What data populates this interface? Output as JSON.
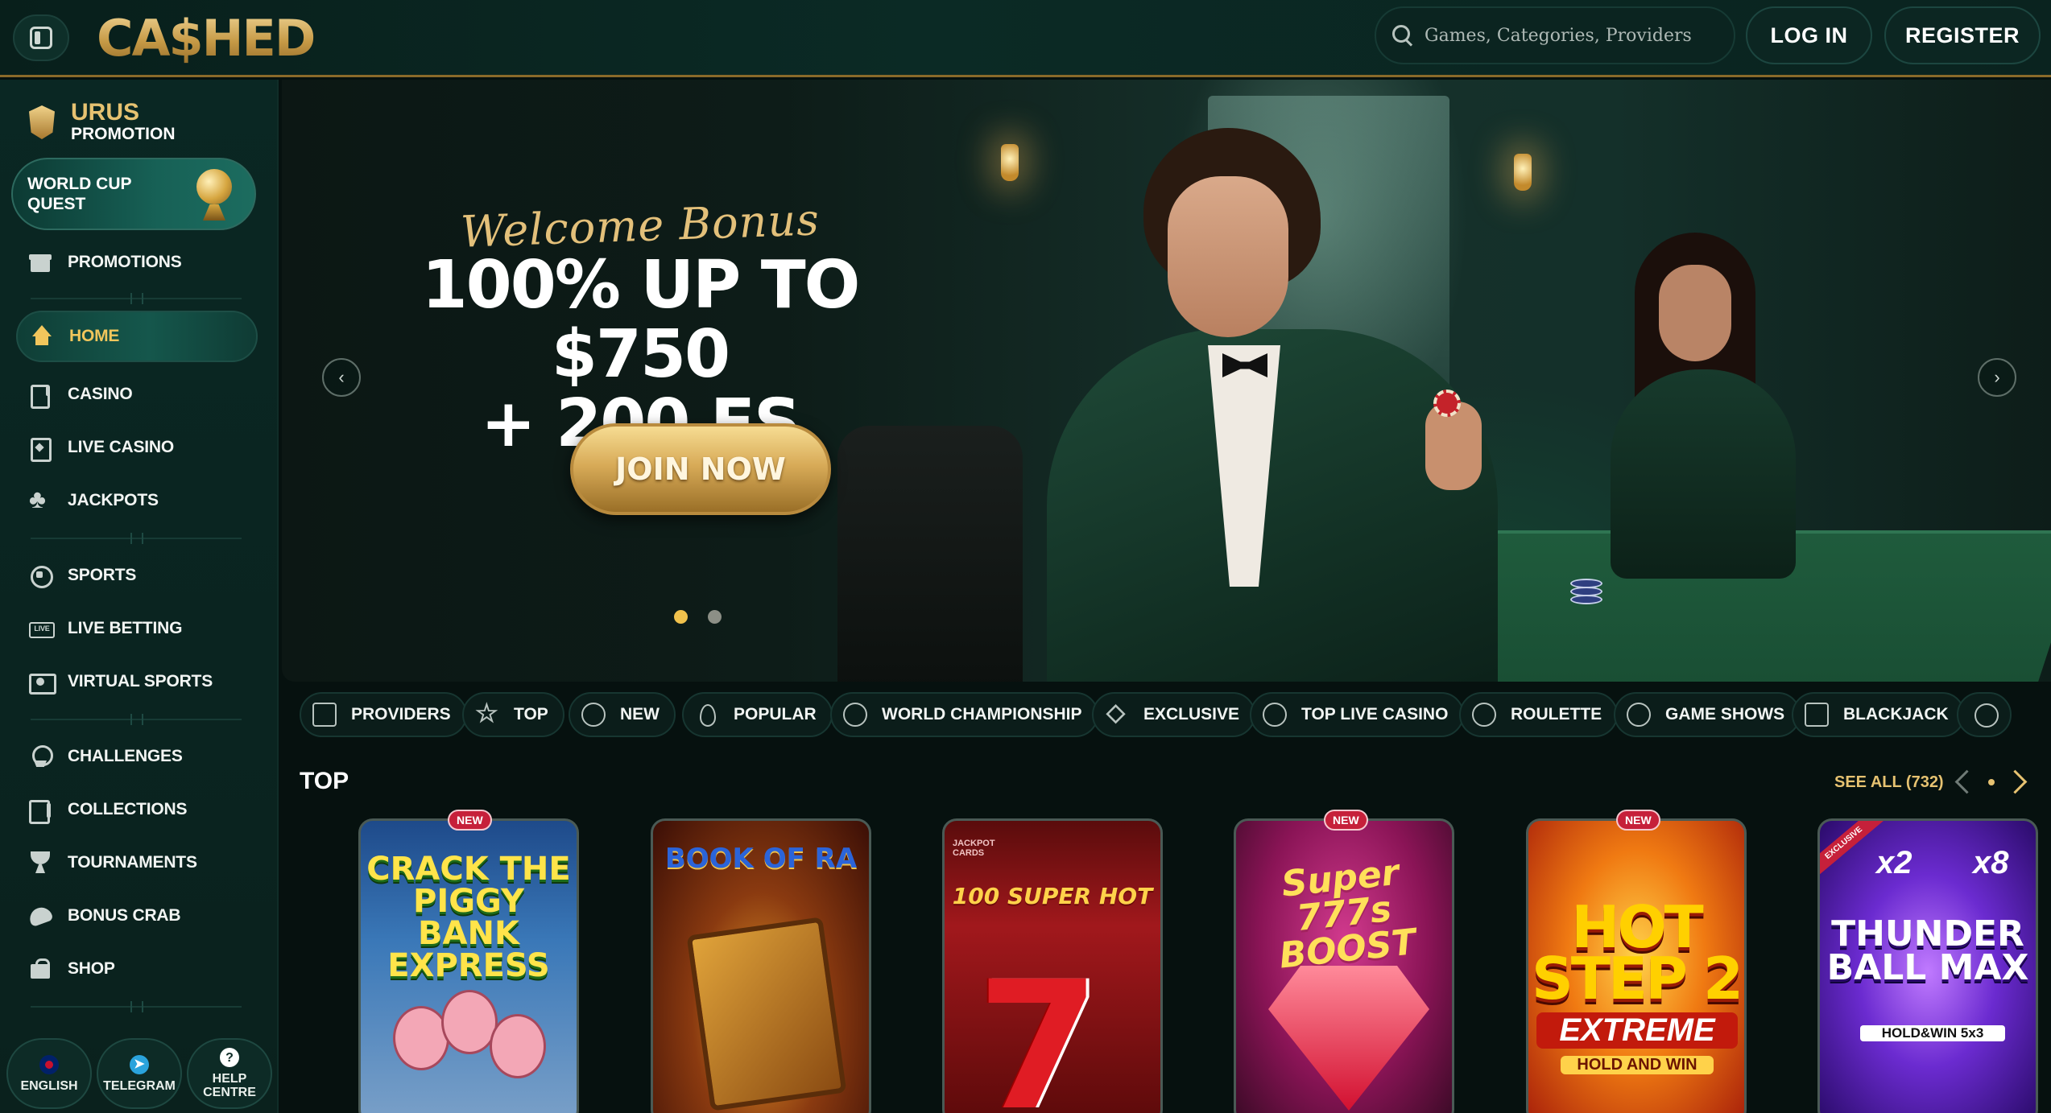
{
  "header": {
    "logo": "CA$HED",
    "search_placeholder": "Games, Categories, Providers",
    "login_label": "LOG IN",
    "register_label": "REGISTER"
  },
  "sidebar": {
    "promo_title": "URUS",
    "promo_subtitle": "PROMOTION",
    "world_cup": "WORLD CUP QUEST",
    "items": [
      {
        "label": "PROMOTIONS",
        "icon": "gift-icon"
      },
      {
        "label": "HOME",
        "icon": "home-icon",
        "active": true
      },
      {
        "label": "CASINO",
        "icon": "slot-machine-icon"
      },
      {
        "label": "LIVE CASINO",
        "icon": "live-cards-icon"
      },
      {
        "label": "JACKPOTS",
        "icon": "clover-icon"
      },
      {
        "label": "SPORTS",
        "icon": "football-icon"
      },
      {
        "label": "LIVE BETTING",
        "icon": "live-badge-icon"
      },
      {
        "label": "VIRTUAL SPORTS",
        "icon": "virtual-screen-icon"
      },
      {
        "label": "CHALLENGES",
        "icon": "medal-icon"
      },
      {
        "label": "COLLECTIONS",
        "icon": "cards-collection-icon"
      },
      {
        "label": "TOURNAMENTS",
        "icon": "trophy-icon"
      },
      {
        "label": "BONUS CRAB",
        "icon": "crab-claw-icon"
      },
      {
        "label": "SHOP",
        "icon": "shopping-bag-icon"
      }
    ],
    "bottom": [
      {
        "label": "ENGLISH",
        "icon": "flag-icon"
      },
      {
        "label": "TELEGRAM",
        "icon": "telegram-icon"
      },
      {
        "label": "HELP CENTRE",
        "icon": "help-icon",
        "glyph": "?"
      }
    ]
  },
  "hero": {
    "welcome": "Welcome Bonus",
    "line1": "100% UP TO $750",
    "line2": "+ 200 FS",
    "cta": "JOIN NOW",
    "slides": 2,
    "active_slide": 1
  },
  "categories": [
    {
      "label": "PROVIDERS"
    },
    {
      "label": "TOP"
    },
    {
      "label": "NEW"
    },
    {
      "label": "POPULAR"
    },
    {
      "label": "WORLD CHAMPIONSHIP"
    },
    {
      "label": "EXCLUSIVE"
    },
    {
      "label": "TOP LIVE CASINO"
    },
    {
      "label": "ROULETTE"
    },
    {
      "label": "GAME SHOWS"
    },
    {
      "label": "BLACKJACK"
    }
  ],
  "top_section": {
    "title": "TOP",
    "see_all": "SEE ALL (732)",
    "games": [
      {
        "title": "CRACK THE PIGGY BANK EXPRESS",
        "badge": "NEW"
      },
      {
        "title": "BOOK OF RA"
      },
      {
        "title": "100 SUPER HOT",
        "corner": "JACKPOT CARDS"
      },
      {
        "title": "Super 777s BOOST",
        "badge": "NEW"
      },
      {
        "title": "HOT STEP 2",
        "subtitle": "EXTREME",
        "tag": "HOLD AND WIN",
        "badge": "NEW"
      },
      {
        "title": "THUNDER BALL MAX",
        "tag": "HOLD&WIN 5x3",
        "ribbon": "EXCLUSIVE",
        "mult1": "x2",
        "mult2": "x8"
      }
    ]
  },
  "colors": {
    "accent_gold": "#e6c271",
    "active_nav": "#f1c65c",
    "badge_red": "#c6203a",
    "bg": "#06110f"
  }
}
